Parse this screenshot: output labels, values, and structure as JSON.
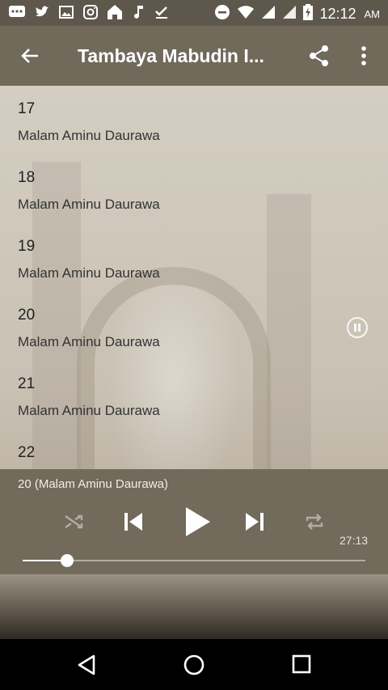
{
  "status_bar": {
    "time": "12:12",
    "ampm": "AM",
    "left_icons": [
      "chat-icon",
      "twitter-icon",
      "image-icon",
      "instagram-icon",
      "home-icon",
      "music-note-icon",
      "download-done-icon"
    ],
    "right_icons": [
      "do-not-disturb-icon",
      "wifi-icon",
      "signal-icon",
      "signal-icon",
      "battery-charging-icon"
    ]
  },
  "app_bar": {
    "title": "Tambaya Mabudin I..."
  },
  "tracks": [
    {
      "number": "17",
      "artist": "Malam Aminu Daurawa"
    },
    {
      "number": "18",
      "artist": "Malam Aminu Daurawa"
    },
    {
      "number": "19",
      "artist": "Malam Aminu Daurawa"
    },
    {
      "number": "20",
      "artist": "Malam Aminu Daurawa"
    },
    {
      "number": "21",
      "artist": "Malam Aminu Daurawa"
    },
    {
      "number": "22",
      "artist": ""
    }
  ],
  "player": {
    "now_playing": "20 (Malam Aminu Daurawa)",
    "duration": "27:13",
    "progress": 0.13,
    "accent": "#ffffff"
  }
}
